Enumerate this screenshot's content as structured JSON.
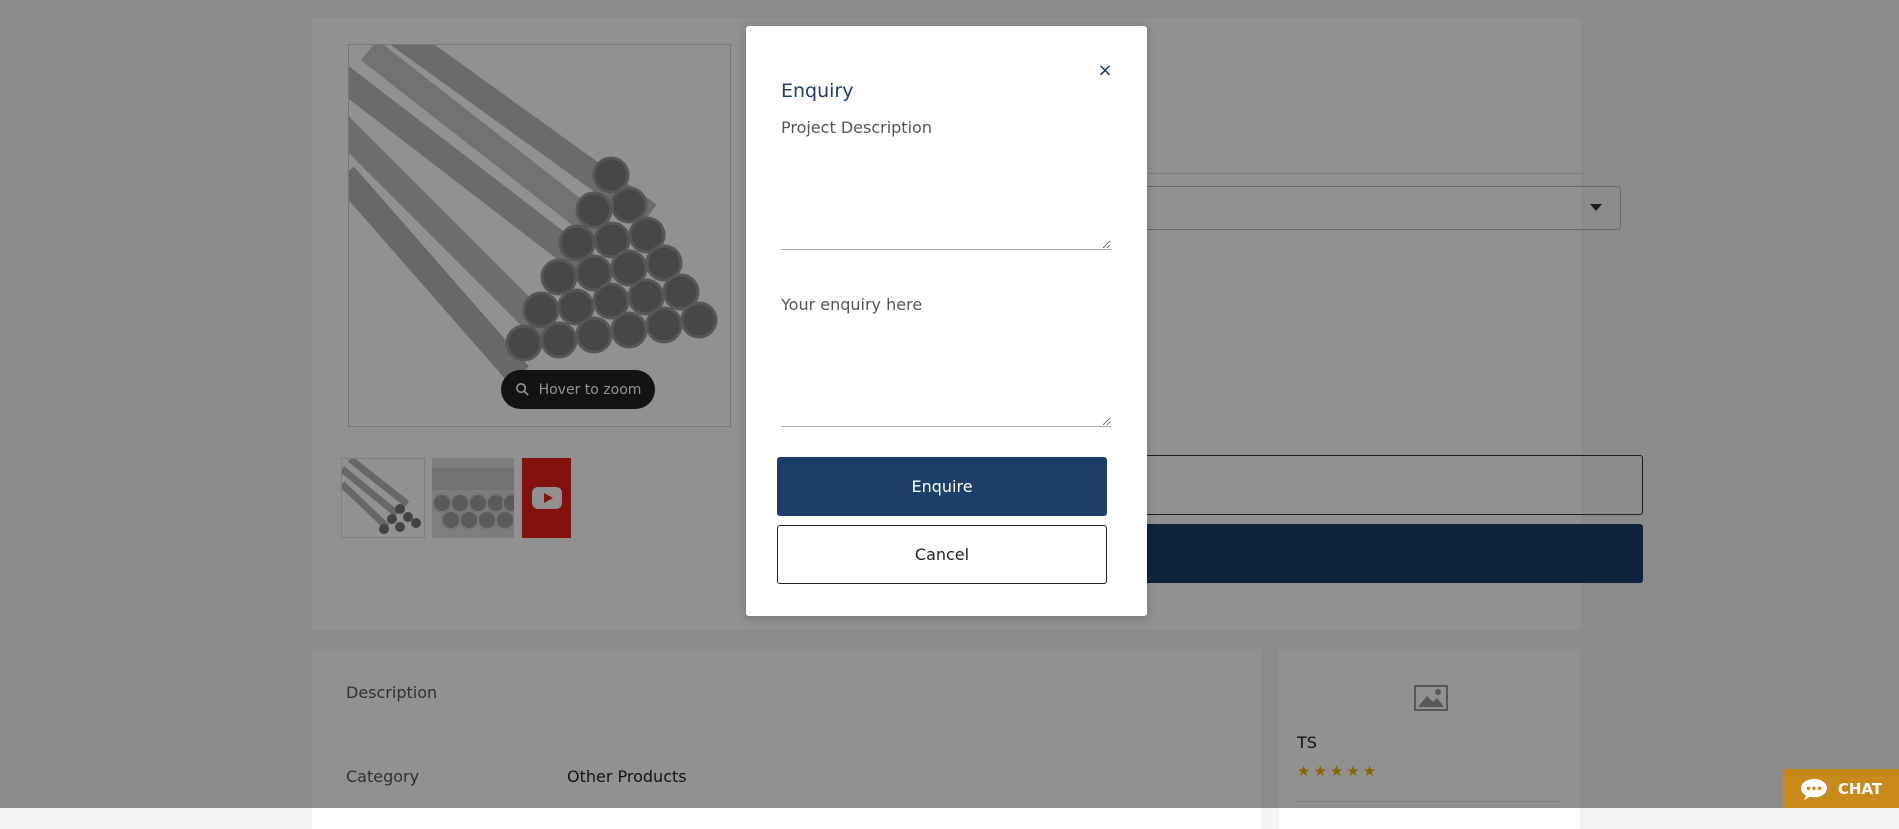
{
  "product": {
    "zoom_hint": "Hover to zoom",
    "thumbnails": [
      "pipes-photo-thumbnail",
      "pipes-stack-thumbnail",
      "youtube-video-thumbnail"
    ]
  },
  "description": {
    "title": "Description",
    "category_label": "Category",
    "category_value": "Other Products"
  },
  "seller": {
    "name": "TS",
    "rating_stars": 5
  },
  "modal": {
    "title": "Enquiry",
    "close_label": "×",
    "project_description_label": "Project Description",
    "enquiry_label": "Your enquiry here",
    "enquire_button": "Enquire",
    "cancel_button": "Cancel"
  },
  "chat": {
    "label": "CHAT"
  },
  "colors": {
    "primary": "#1b3f68",
    "chat": "#c88a1a",
    "youtube": "#e62117",
    "stars": "#f2b100"
  }
}
